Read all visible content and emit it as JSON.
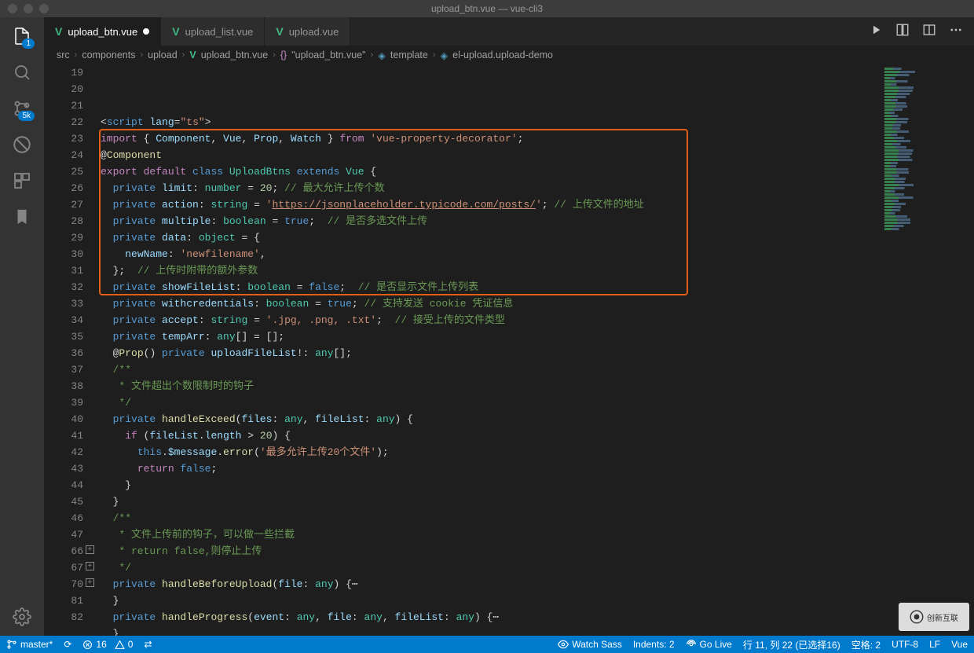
{
  "title": "upload_btn.vue — vue-cli3",
  "tabs": [
    {
      "label": "upload_btn.vue",
      "active": true,
      "modified": true
    },
    {
      "label": "upload_list.vue",
      "active": false,
      "modified": false
    },
    {
      "label": "upload.vue",
      "active": false,
      "modified": false
    }
  ],
  "breadcrumbs": [
    "src",
    "components",
    "upload",
    "upload_btn.vue",
    "\"upload_btn.vue\"",
    "template",
    "el-upload.upload-demo"
  ],
  "activity_badges": {
    "explorer": "1",
    "scm": "5k"
  },
  "line_numbers": [
    "19",
    "20",
    "21",
    "22",
    "23",
    "24",
    "25",
    "26",
    "27",
    "28",
    "29",
    "30",
    "31",
    "32",
    "33",
    "34",
    "35",
    "36",
    "37",
    "38",
    "39",
    "40",
    "41",
    "42",
    "43",
    "44",
    "45",
    "46",
    "47",
    "66",
    "67",
    "70",
    "81",
    "82"
  ],
  "folded_lines": [
    29,
    30,
    31
  ],
  "code_tokens": [
    [
      {
        "t": "<",
        "c": "punct"
      },
      {
        "t": "script",
        "c": "kw"
      },
      {
        "t": " ",
        "c": ""
      },
      {
        "t": "lang",
        "c": "var"
      },
      {
        "t": "=",
        "c": "punct"
      },
      {
        "t": "\"ts\"",
        "c": "str"
      },
      {
        "t": ">",
        "c": "punct"
      }
    ],
    [
      {
        "t": "import",
        "c": "kw2"
      },
      {
        "t": " { ",
        "c": "punct"
      },
      {
        "t": "Component",
        "c": "var"
      },
      {
        "t": ", ",
        "c": "punct"
      },
      {
        "t": "Vue",
        "c": "var"
      },
      {
        "t": ", ",
        "c": "punct"
      },
      {
        "t": "Prop",
        "c": "var"
      },
      {
        "t": ", ",
        "c": "punct"
      },
      {
        "t": "Watch",
        "c": "var"
      },
      {
        "t": " } ",
        "c": "punct"
      },
      {
        "t": "from",
        "c": "kw2"
      },
      {
        "t": " ",
        "c": ""
      },
      {
        "t": "'vue-property-decorator'",
        "c": "str"
      },
      {
        "t": ";",
        "c": "punct"
      }
    ],
    [
      {
        "t": "@",
        "c": "punct"
      },
      {
        "t": "Component",
        "c": "deco"
      }
    ],
    [
      {
        "t": "export",
        "c": "kw2"
      },
      {
        "t": " ",
        "c": ""
      },
      {
        "t": "default",
        "c": "kw2"
      },
      {
        "t": " ",
        "c": ""
      },
      {
        "t": "class",
        "c": "kw"
      },
      {
        "t": " ",
        "c": ""
      },
      {
        "t": "UploadBtns",
        "c": "cls"
      },
      {
        "t": " ",
        "c": ""
      },
      {
        "t": "extends",
        "c": "kw"
      },
      {
        "t": " ",
        "c": ""
      },
      {
        "t": "Vue",
        "c": "cls"
      },
      {
        "t": " {",
        "c": "punct"
      }
    ],
    [
      {
        "t": "  ",
        "c": ""
      },
      {
        "t": "private",
        "c": "kw"
      },
      {
        "t": " ",
        "c": ""
      },
      {
        "t": "limit",
        "c": "var"
      },
      {
        "t": ": ",
        "c": "punct"
      },
      {
        "t": "number",
        "c": "cls"
      },
      {
        "t": " = ",
        "c": "punct"
      },
      {
        "t": "20",
        "c": "num"
      },
      {
        "t": "; ",
        "c": "punct"
      },
      {
        "t": "// 最大允许上传个数",
        "c": "cmt"
      }
    ],
    [
      {
        "t": "  ",
        "c": ""
      },
      {
        "t": "private",
        "c": "kw"
      },
      {
        "t": " ",
        "c": ""
      },
      {
        "t": "action",
        "c": "var"
      },
      {
        "t": ": ",
        "c": "punct"
      },
      {
        "t": "string",
        "c": "cls"
      },
      {
        "t": " = ",
        "c": "punct"
      },
      {
        "t": "'",
        "c": "str"
      },
      {
        "t": "https://jsonplaceholder.typicode.com/posts/",
        "c": "str underline"
      },
      {
        "t": "'",
        "c": "str"
      },
      {
        "t": "; ",
        "c": "punct"
      },
      {
        "t": "// 上传文件的地址",
        "c": "cmt"
      }
    ],
    [
      {
        "t": "  ",
        "c": ""
      },
      {
        "t": "private",
        "c": "kw"
      },
      {
        "t": " ",
        "c": ""
      },
      {
        "t": "multiple",
        "c": "var"
      },
      {
        "t": ": ",
        "c": "punct"
      },
      {
        "t": "boolean",
        "c": "cls"
      },
      {
        "t": " = ",
        "c": "punct"
      },
      {
        "t": "true",
        "c": "kw"
      },
      {
        "t": ";  ",
        "c": "punct"
      },
      {
        "t": "// 是否多选文件上传",
        "c": "cmt"
      }
    ],
    [
      {
        "t": "  ",
        "c": ""
      },
      {
        "t": "private",
        "c": "kw"
      },
      {
        "t": " ",
        "c": ""
      },
      {
        "t": "data",
        "c": "var"
      },
      {
        "t": ": ",
        "c": "punct"
      },
      {
        "t": "object",
        "c": "cls"
      },
      {
        "t": " = {",
        "c": "punct"
      }
    ],
    [
      {
        "t": "    ",
        "c": ""
      },
      {
        "t": "newName",
        "c": "var"
      },
      {
        "t": ": ",
        "c": "punct"
      },
      {
        "t": "'newfilename'",
        "c": "str"
      },
      {
        "t": ",",
        "c": "punct"
      }
    ],
    [
      {
        "t": "  };  ",
        "c": "punct"
      },
      {
        "t": "// 上传时附带的额外参数",
        "c": "cmt"
      }
    ],
    [
      {
        "t": "  ",
        "c": ""
      },
      {
        "t": "private",
        "c": "kw"
      },
      {
        "t": " ",
        "c": ""
      },
      {
        "t": "showFileList",
        "c": "var"
      },
      {
        "t": ": ",
        "c": "punct"
      },
      {
        "t": "boolean",
        "c": "cls"
      },
      {
        "t": " = ",
        "c": "punct"
      },
      {
        "t": "false",
        "c": "kw"
      },
      {
        "t": ";  ",
        "c": "punct"
      },
      {
        "t": "// 是否显示文件上传列表",
        "c": "cmt"
      }
    ],
    [
      {
        "t": "  ",
        "c": ""
      },
      {
        "t": "private",
        "c": "kw"
      },
      {
        "t": " ",
        "c": ""
      },
      {
        "t": "withcredentials",
        "c": "var"
      },
      {
        "t": ": ",
        "c": "punct"
      },
      {
        "t": "boolean",
        "c": "cls"
      },
      {
        "t": " = ",
        "c": "punct"
      },
      {
        "t": "true",
        "c": "kw"
      },
      {
        "t": "; ",
        "c": "punct"
      },
      {
        "t": "// 支持发送 cookie 凭证信息",
        "c": "cmt"
      }
    ],
    [
      {
        "t": "  ",
        "c": ""
      },
      {
        "t": "private",
        "c": "kw"
      },
      {
        "t": " ",
        "c": ""
      },
      {
        "t": "accept",
        "c": "var"
      },
      {
        "t": ": ",
        "c": "punct"
      },
      {
        "t": "string",
        "c": "cls"
      },
      {
        "t": " = ",
        "c": "punct"
      },
      {
        "t": "'.jpg, .png, .txt'",
        "c": "str"
      },
      {
        "t": ";  ",
        "c": "punct"
      },
      {
        "t": "// 接受上传的文件类型",
        "c": "cmt"
      }
    ],
    [
      {
        "t": "  ",
        "c": ""
      },
      {
        "t": "private",
        "c": "kw"
      },
      {
        "t": " ",
        "c": ""
      },
      {
        "t": "tempArr",
        "c": "var"
      },
      {
        "t": ": ",
        "c": "punct"
      },
      {
        "t": "any",
        "c": "cls"
      },
      {
        "t": "[] = [];",
        "c": "punct"
      }
    ],
    [
      {
        "t": "  ",
        "c": ""
      },
      {
        "t": "@",
        "c": "punct"
      },
      {
        "t": "Prop",
        "c": "deco"
      },
      {
        "t": "() ",
        "c": "punct"
      },
      {
        "t": "private",
        "c": "kw"
      },
      {
        "t": " ",
        "c": ""
      },
      {
        "t": "uploadFileList",
        "c": "var"
      },
      {
        "t": "!: ",
        "c": "punct"
      },
      {
        "t": "any",
        "c": "cls"
      },
      {
        "t": "[];",
        "c": "punct"
      }
    ],
    [
      {
        "t": "  ",
        "c": ""
      },
      {
        "t": "/**",
        "c": "cmt"
      }
    ],
    [
      {
        "t": "   * 文件超出个数限制时的钩子",
        "c": "cmt"
      }
    ],
    [
      {
        "t": "   */",
        "c": "cmt"
      }
    ],
    [
      {
        "t": "  ",
        "c": ""
      },
      {
        "t": "private",
        "c": "kw"
      },
      {
        "t": " ",
        "c": ""
      },
      {
        "t": "handleExceed",
        "c": "fn"
      },
      {
        "t": "(",
        "c": "punct"
      },
      {
        "t": "files",
        "c": "var"
      },
      {
        "t": ": ",
        "c": "punct"
      },
      {
        "t": "any",
        "c": "cls"
      },
      {
        "t": ", ",
        "c": "punct"
      },
      {
        "t": "fileList",
        "c": "var"
      },
      {
        "t": ": ",
        "c": "punct"
      },
      {
        "t": "any",
        "c": "cls"
      },
      {
        "t": ") {",
        "c": "punct"
      }
    ],
    [
      {
        "t": "    ",
        "c": ""
      },
      {
        "t": "if",
        "c": "kw2"
      },
      {
        "t": " (",
        "c": "punct"
      },
      {
        "t": "fileList",
        "c": "var"
      },
      {
        "t": ".",
        "c": "punct"
      },
      {
        "t": "length",
        "c": "var"
      },
      {
        "t": " > ",
        "c": "punct"
      },
      {
        "t": "20",
        "c": "num"
      },
      {
        "t": ") {",
        "c": "punct"
      }
    ],
    [
      {
        "t": "      ",
        "c": ""
      },
      {
        "t": "this",
        "c": "kw"
      },
      {
        "t": ".",
        "c": "punct"
      },
      {
        "t": "$message",
        "c": "var"
      },
      {
        "t": ".",
        "c": "punct"
      },
      {
        "t": "error",
        "c": "fn"
      },
      {
        "t": "(",
        "c": "punct"
      },
      {
        "t": "'最多允许上传20个文件'",
        "c": "str"
      },
      {
        "t": ");",
        "c": "punct"
      }
    ],
    [
      {
        "t": "      ",
        "c": ""
      },
      {
        "t": "return",
        "c": "kw2"
      },
      {
        "t": " ",
        "c": ""
      },
      {
        "t": "false",
        "c": "kw"
      },
      {
        "t": ";",
        "c": "punct"
      }
    ],
    [
      {
        "t": "    }",
        "c": "punct"
      }
    ],
    [
      {
        "t": "  }",
        "c": "punct"
      }
    ],
    [
      {
        "t": "  ",
        "c": ""
      },
      {
        "t": "/**",
        "c": "cmt"
      }
    ],
    [
      {
        "t": "   * 文件上传前的钩子，可以做一些拦截",
        "c": "cmt"
      }
    ],
    [
      {
        "t": "   * return false,则停止上传",
        "c": "cmt"
      }
    ],
    [
      {
        "t": "   */",
        "c": "cmt"
      }
    ],
    [
      {
        "t": "  ",
        "c": ""
      },
      {
        "t": "private",
        "c": "kw"
      },
      {
        "t": " ",
        "c": ""
      },
      {
        "t": "handleBeforeUpload",
        "c": "fn"
      },
      {
        "t": "(",
        "c": "punct"
      },
      {
        "t": "file",
        "c": "var"
      },
      {
        "t": ": ",
        "c": "punct"
      },
      {
        "t": "any",
        "c": "cls"
      },
      {
        "t": ") {",
        "c": "punct"
      },
      {
        "t": "⋯",
        "c": "punct"
      }
    ],
    [
      {
        "t": "  }",
        "c": "punct"
      }
    ],
    [
      {
        "t": "  ",
        "c": ""
      },
      {
        "t": "private",
        "c": "kw"
      },
      {
        "t": " ",
        "c": ""
      },
      {
        "t": "handleProgress",
        "c": "fn"
      },
      {
        "t": "(",
        "c": "punct"
      },
      {
        "t": "event",
        "c": "var"
      },
      {
        "t": ": ",
        "c": "punct"
      },
      {
        "t": "any",
        "c": "cls"
      },
      {
        "t": ", ",
        "c": "punct"
      },
      {
        "t": "file",
        "c": "var"
      },
      {
        "t": ": ",
        "c": "punct"
      },
      {
        "t": "any",
        "c": "cls"
      },
      {
        "t": ", ",
        "c": "punct"
      },
      {
        "t": "fileList",
        "c": "var"
      },
      {
        "t": ": ",
        "c": "punct"
      },
      {
        "t": "any",
        "c": "cls"
      },
      {
        "t": ") {",
        "c": "punct"
      },
      {
        "t": "⋯",
        "c": "punct"
      }
    ],
    [
      {
        "t": "  }",
        "c": "punct"
      }
    ],
    [
      {
        "t": "  ",
        "c": ""
      },
      {
        "t": "/**",
        "c": "cmt"
      },
      {
        "t": "⋯",
        "c": "cmt"
      }
    ]
  ],
  "status": {
    "branch": "master*",
    "sync": "⟳",
    "errors": "16",
    "warnings": "0",
    "watch_sass": "Watch Sass",
    "go_live": "Go Live",
    "indents": "Indents: 2",
    "cursor": "行 11,  列 22 (已选择16)",
    "spaces": "空格: 2",
    "encoding": "UTF-8",
    "eol": "LF",
    "lang": "Vue"
  },
  "watermark": "创新互联"
}
